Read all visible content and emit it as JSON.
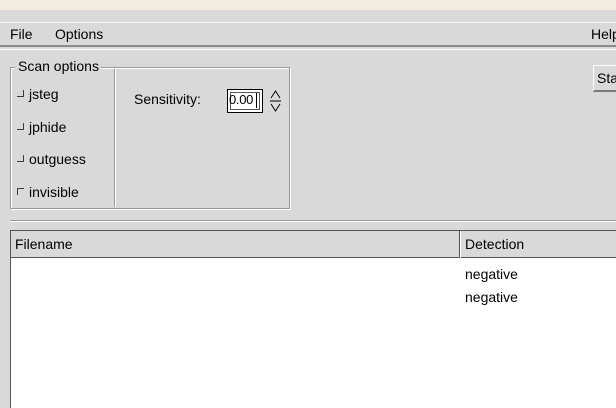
{
  "menubar": {
    "file": "File",
    "options": "Options",
    "help": "Help"
  },
  "scan_options": {
    "title": "Scan options",
    "checkboxes": [
      {
        "label": "jsteg",
        "checked": false
      },
      {
        "label": "jphide",
        "checked": false
      },
      {
        "label": "outguess",
        "checked": false
      },
      {
        "label": "invisible",
        "checked": true
      }
    ],
    "sensitivity_label": "Sensitivity:",
    "sensitivity_value": "0.00"
  },
  "toolbar": {
    "start_label": "Start"
  },
  "table": {
    "columns": [
      "Filename",
      "Detection"
    ],
    "rows": [
      {
        "filename": "",
        "detection": "negative"
      },
      {
        "filename": "",
        "detection": "negative"
      }
    ]
  }
}
